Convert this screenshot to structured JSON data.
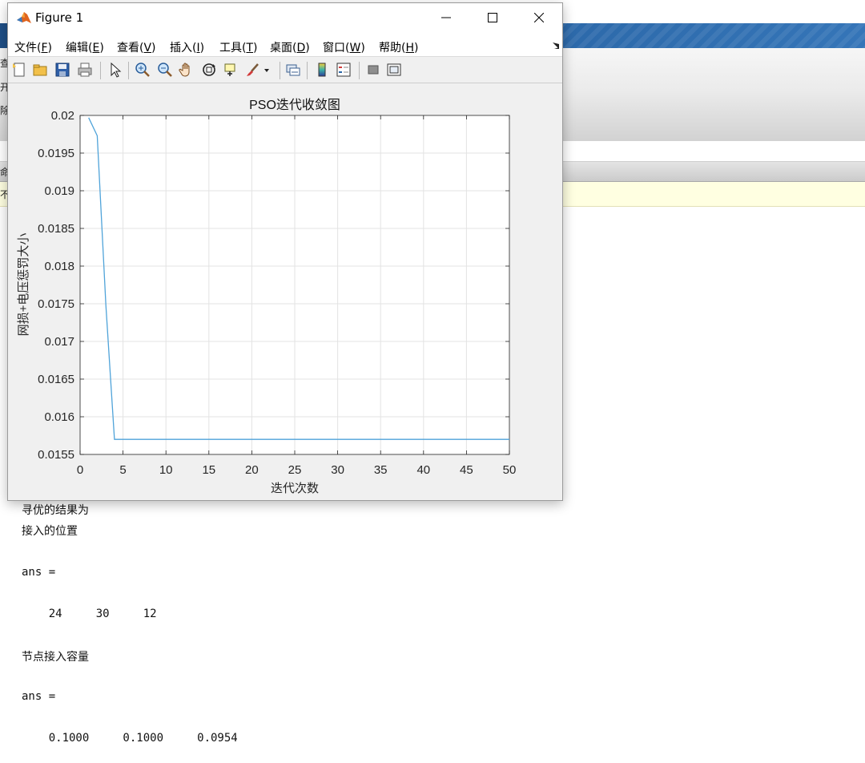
{
  "figure": {
    "title": "Figure 1",
    "menu": [
      {
        "label": "文件(",
        "key": "F",
        "tail": ")"
      },
      {
        "label": "编辑(",
        "key": "E",
        "tail": ")"
      },
      {
        "label": "查看(",
        "key": "V",
        "tail": ")"
      },
      {
        "label": "插入(",
        "key": "I",
        "tail": ")"
      },
      {
        "label": "工具(",
        "key": "T",
        "tail": ")"
      },
      {
        "label": "桌面(",
        "key": "D",
        "tail": ")"
      },
      {
        "label": "窗口(",
        "key": "W",
        "tail": ")"
      },
      {
        "label": "帮助(",
        "key": "H",
        "tail": ")"
      }
    ],
    "toolbar_icons": [
      "new-figure-icon",
      "open-file-icon",
      "save-icon",
      "print-icon",
      "pointer-icon",
      "zoom-in-icon",
      "zoom-out-icon",
      "pan-hand-icon",
      "rotate-3d-icon",
      "data-cursor-icon",
      "brush-icon",
      "brush-dropdown-icon",
      "link-plot-icon",
      "colorbar-icon",
      "legend-icon",
      "hide-plot-tools-icon",
      "show-plot-tools-icon"
    ]
  },
  "chart_data": {
    "type": "line",
    "title": "PSO迭代收敛图",
    "xlabel": "迭代次数",
    "ylabel": "网损+电压惩罚大小",
    "xlim": [
      0,
      50
    ],
    "ylim": [
      0.0155,
      0.02
    ],
    "xticks": [
      0,
      5,
      10,
      15,
      20,
      25,
      30,
      35,
      40,
      45,
      50
    ],
    "yticks": [
      "0.0155",
      "0.016",
      "0.0165",
      "0.017",
      "0.0175",
      "0.018",
      "0.0185",
      "0.019",
      "0.0195",
      "0.02"
    ],
    "grid": true,
    "line_color": "#4fa3d9",
    "series": [
      {
        "x": [
          1,
          2,
          3,
          4,
          5,
          10,
          20,
          30,
          40,
          50
        ],
        "values": [
          0.01997,
          0.01973,
          0.01748,
          0.0157,
          0.0157,
          0.0157,
          0.0157,
          0.0157,
          0.0157,
          0.0157
        ]
      }
    ]
  },
  "command_window": {
    "lines": [
      "寻优的结果为",
      "接入的位置",
      "",
      "ans =",
      "",
      "    24     30     12",
      "",
      "节点接入容量",
      "",
      "ans =",
      "",
      "    0.1000     0.1000     0.0954"
    ]
  },
  "desktop": {
    "fragments": [
      "查",
      "开",
      "除",
      "命",
      "不"
    ]
  }
}
